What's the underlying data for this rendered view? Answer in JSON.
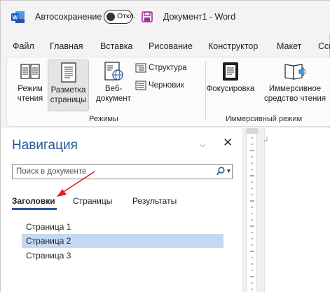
{
  "titlebar": {
    "autosave_label": "Автосохранение",
    "autosave_toggle_text": "Откл.",
    "document_title": "Документ1  -  Word",
    "word_color": "#2b579a"
  },
  "menu": {
    "tabs": [
      "Файл",
      "Главная",
      "Вставка",
      "Рисование",
      "Конструктор",
      "Макет",
      "Ссы"
    ]
  },
  "ribbon": {
    "modes": {
      "read_mode": "Режим\nчтения",
      "print_layout": "Разметка\nстраницы",
      "web_layout": "Веб-\nдокумент",
      "outline": "Структура",
      "draft": "Черновик",
      "group_label": "Режимы"
    },
    "immersive": {
      "focus": "Фокусировка",
      "immersive_reader": "Иммерсивное\nсредство чтения",
      "group_label": "Иммерсивный режим"
    }
  },
  "navigation": {
    "title": "Навигация",
    "search_placeholder": "Поиск в документе",
    "tabs": [
      "Заголовки",
      "Страницы",
      "Результаты"
    ],
    "active_tab": "Заголовки",
    "headings": [
      "Страница 1",
      "Страница 2",
      "Страница 3"
    ],
    "selected_heading": "Страница 2"
  },
  "colors": {
    "accent": "#2b579a",
    "selection": "#c5d8f3",
    "annotation_arrow": "#e02020"
  }
}
